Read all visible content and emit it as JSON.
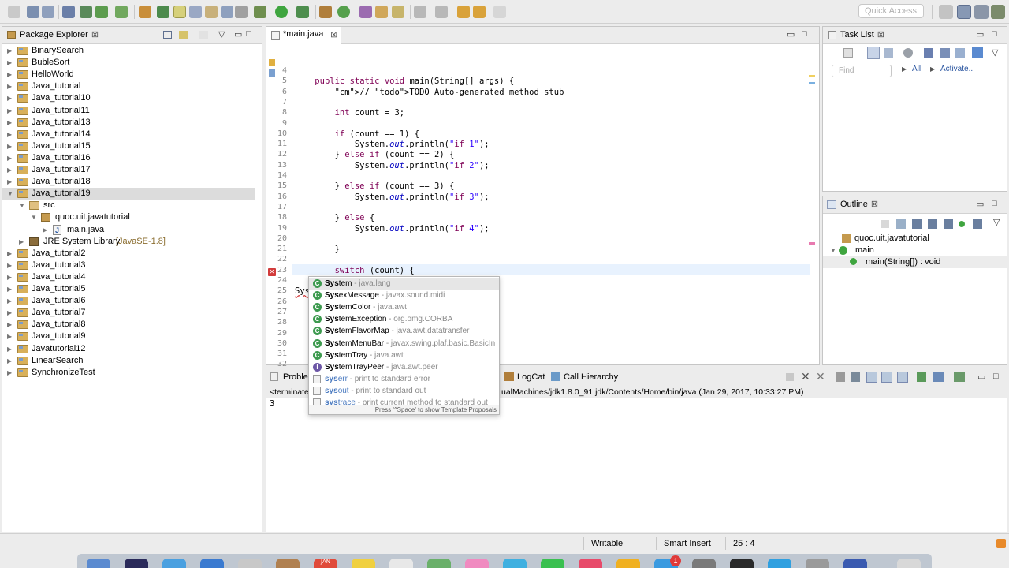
{
  "toolbar": {
    "quick_access_placeholder": "Quick Access"
  },
  "package_explorer": {
    "title": "Package Explorer",
    "items": [
      {
        "label": "BinarySearch",
        "level": 0,
        "type": "project",
        "expanded": false
      },
      {
        "label": "BubleSort",
        "level": 0,
        "type": "project",
        "expanded": false
      },
      {
        "label": "HelloWorld",
        "level": 0,
        "type": "project",
        "expanded": false
      },
      {
        "label": "Java_tutorial",
        "level": 0,
        "type": "project",
        "expanded": false
      },
      {
        "label": "Java_tutorial10",
        "level": 0,
        "type": "project",
        "expanded": false
      },
      {
        "label": "Java_tutorial11",
        "level": 0,
        "type": "project",
        "expanded": false
      },
      {
        "label": "Java_tutorial13",
        "level": 0,
        "type": "project",
        "expanded": false
      },
      {
        "label": "Java_tutorial14",
        "level": 0,
        "type": "project",
        "expanded": false
      },
      {
        "label": "Java_tutorial15",
        "level": 0,
        "type": "project",
        "expanded": false
      },
      {
        "label": "Java_tutorial16",
        "level": 0,
        "type": "project",
        "expanded": false
      },
      {
        "label": "Java_tutorial17",
        "level": 0,
        "type": "project",
        "expanded": false
      },
      {
        "label": "Java_tutorial18",
        "level": 0,
        "type": "project",
        "expanded": false
      },
      {
        "label": "Java_tutorial19",
        "level": 0,
        "type": "project",
        "expanded": true,
        "selected": true
      },
      {
        "label": "src",
        "level": 1,
        "type": "src",
        "expanded": true
      },
      {
        "label": "quoc.uit.javatutorial",
        "level": 2,
        "type": "package",
        "expanded": true
      },
      {
        "label": "main.java",
        "level": 3,
        "type": "java",
        "expanded": false
      },
      {
        "label": "JRE System Library",
        "decoration": "[JavaSE-1.8]",
        "level": 1,
        "type": "jre",
        "expanded": false
      },
      {
        "label": "Java_tutorial2",
        "level": 0,
        "type": "project",
        "expanded": false
      },
      {
        "label": "Java_tutorial3",
        "level": 0,
        "type": "project",
        "expanded": false
      },
      {
        "label": "Java_tutorial4",
        "level": 0,
        "type": "project",
        "expanded": false
      },
      {
        "label": "Java_tutorial5",
        "level": 0,
        "type": "project",
        "expanded": false
      },
      {
        "label": "Java_tutorial6",
        "level": 0,
        "type": "project",
        "expanded": false
      },
      {
        "label": "Java_tutorial7",
        "level": 0,
        "type": "project",
        "expanded": false
      },
      {
        "label": "Java_tutorial8",
        "level": 0,
        "type": "project",
        "expanded": false
      },
      {
        "label": "Java_tutorial9",
        "level": 0,
        "type": "project",
        "expanded": false
      },
      {
        "label": "Javatutorial12",
        "level": 0,
        "type": "project",
        "expanded": false
      },
      {
        "label": "LinearSearch",
        "level": 0,
        "type": "project",
        "expanded": false
      },
      {
        "label": "SynchronizeTest",
        "level": 0,
        "type": "project",
        "expanded": false
      }
    ]
  },
  "editor": {
    "tab_label": "*main.java",
    "lines": [
      {
        "n": "4",
        "code": ""
      },
      {
        "n": "5",
        "code": "    public static void main(String[] args) {"
      },
      {
        "n": "6",
        "code": "        // TODO Auto-generated method stub"
      },
      {
        "n": "7",
        "code": ""
      },
      {
        "n": "8",
        "code": "        int count = 3;"
      },
      {
        "n": "9",
        "code": ""
      },
      {
        "n": "10",
        "code": "        if (count == 1) {"
      },
      {
        "n": "11",
        "code": "            System.out.println(\"if 1\");"
      },
      {
        "n": "12",
        "code": "        } else if (count == 2) {"
      },
      {
        "n": "13",
        "code": "            System.out.println(\"if 2\");"
      },
      {
        "n": "14",
        "code": ""
      },
      {
        "n": "15",
        "code": "        } else if (count == 3) {"
      },
      {
        "n": "16",
        "code": "            System.out.println(\"if 3\");"
      },
      {
        "n": "17",
        "code": ""
      },
      {
        "n": "18",
        "code": "        } else {"
      },
      {
        "n": "19",
        "code": "            System.out.println(\"if 4\");"
      },
      {
        "n": "20",
        "code": ""
      },
      {
        "n": "21",
        "code": "        }"
      },
      {
        "n": "22",
        "code": ""
      },
      {
        "n": "23",
        "code": "        switch (count) {"
      },
      {
        "n": "24",
        "code": "        case 1:"
      },
      {
        "n": "25",
        "code": "Sys"
      },
      {
        "n": "26",
        "code": ""
      },
      {
        "n": "27",
        "code": ""
      },
      {
        "n": "28",
        "code": ""
      },
      {
        "n": "29",
        "code": ""
      },
      {
        "n": "30",
        "code": ""
      },
      {
        "n": "31",
        "code": ""
      },
      {
        "n": "32",
        "code": ""
      },
      {
        "n": "33",
        "code": ""
      }
    ]
  },
  "content_assist": {
    "proposals": [
      {
        "match": "Sys",
        "rest": "tem",
        "desc": " - java.lang",
        "kind": "class",
        "selected": true
      },
      {
        "match": "Sys",
        "rest": "exMessage",
        "desc": " - javax.sound.midi",
        "kind": "class"
      },
      {
        "match": "Sys",
        "rest": "temColor",
        "desc": " - java.awt",
        "kind": "class"
      },
      {
        "match": "Sys",
        "rest": "temException",
        "desc": " - org.omg.CORBA",
        "kind": "class"
      },
      {
        "match": "Sys",
        "rest": "temFlavorMap",
        "desc": " - java.awt.datatransfer",
        "kind": "class"
      },
      {
        "match": "Sys",
        "rest": "temMenuBar",
        "desc": " - javax.swing.plaf.basic.BasicIn",
        "kind": "class"
      },
      {
        "match": "Sys",
        "rest": "temTray",
        "desc": " - java.awt",
        "kind": "class"
      },
      {
        "match": "Sys",
        "rest": "temTrayPeer",
        "desc": " - java.awt.peer",
        "kind": "interface"
      },
      {
        "match": "sys",
        "rest": "err",
        "desc": " - print to standard error",
        "kind": "template"
      },
      {
        "match": "sys",
        "rest": "out",
        "desc": " - print to standard out",
        "kind": "template"
      },
      {
        "match": "sys",
        "rest": "trace",
        "desc": " - print current method to standard out",
        "kind": "template"
      }
    ],
    "footer": "Press '^Space' to show Template Proposals"
  },
  "task_list": {
    "title": "Task List",
    "find_placeholder": "Find",
    "all_label": "All",
    "activate_label": "Activate..."
  },
  "outline": {
    "title": "Outline",
    "items": [
      {
        "label": "quoc.uit.javatutorial",
        "level": 0
      },
      {
        "label": "main",
        "level": 0
      },
      {
        "label": "main(String[]) : void",
        "level": 1
      }
    ]
  },
  "console": {
    "tabs": [
      "Problem",
      "LogCat",
      "Call Hierarchy"
    ],
    "terminated_prefix": "<terminate",
    "terminated_suffix": "ualMachines/jdk1.8.0_91.jdk/Contents/Home/bin/java (Jan 29, 2017, 10:33:27 PM)",
    "output": "3"
  },
  "status_bar": {
    "writable": "Writable",
    "insert_mode": "Smart Insert",
    "position": "25 : 4"
  },
  "dock": {
    "badge": "1",
    "calendar_month": "JAN"
  }
}
